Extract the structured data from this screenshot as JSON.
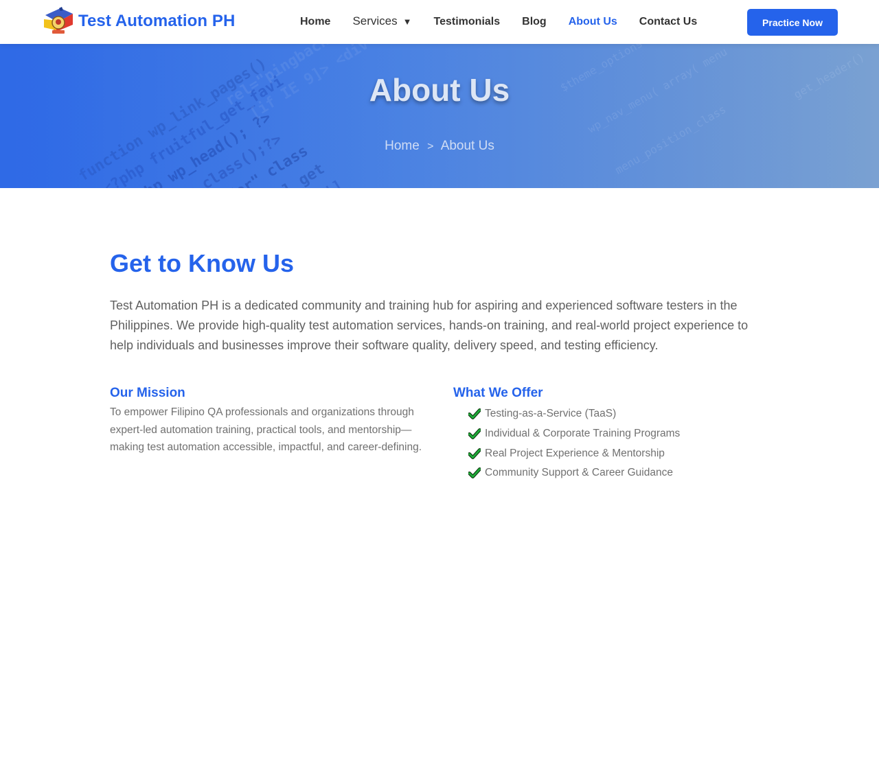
{
  "brand": {
    "name": "Test Automation PH",
    "logo_icon": "philippine-flag-logo"
  },
  "nav": {
    "items": [
      {
        "label": "Home",
        "active": false
      },
      {
        "label": "Services",
        "active": false,
        "has_dropdown": true,
        "caret": "▼"
      },
      {
        "label": "Testimonials",
        "active": false
      },
      {
        "label": "Blog",
        "active": false
      },
      {
        "label": "About Us",
        "active": true
      },
      {
        "label": "Contact Us",
        "active": false
      }
    ],
    "cta_label": "Practice Now"
  },
  "hero": {
    "title": "About Us",
    "breadcrumb": {
      "home": "Home",
      "separator": ">",
      "current": "About Us"
    }
  },
  "main": {
    "title": "Get to Know Us",
    "intro": "Test Automation PH is a dedicated community and training hub for aspiring and experienced software testers in the Philippines. We provide high-quality test automation services, hands-on training, and real-world project experience to help individuals and businesses improve their software quality, delivery speed, and testing efficiency.",
    "mission": {
      "title": "Our Mission",
      "text": "To empower Filipino QA professionals and organizations through expert-led automation training, practical tools, and mentorship—making test automation accessible, impactful, and career-defining."
    },
    "offer": {
      "title": "What We Offer",
      "items": [
        "Testing-as-a-Service (TaaS)",
        "Individual & Corporate Training Programs",
        "Real Project Experience & Mentorship",
        "Community Support & Career Guidance"
      ]
    }
  },
  "colors": {
    "accent": "#2563eb",
    "check": "#16a34a",
    "body_text": "#606060"
  }
}
